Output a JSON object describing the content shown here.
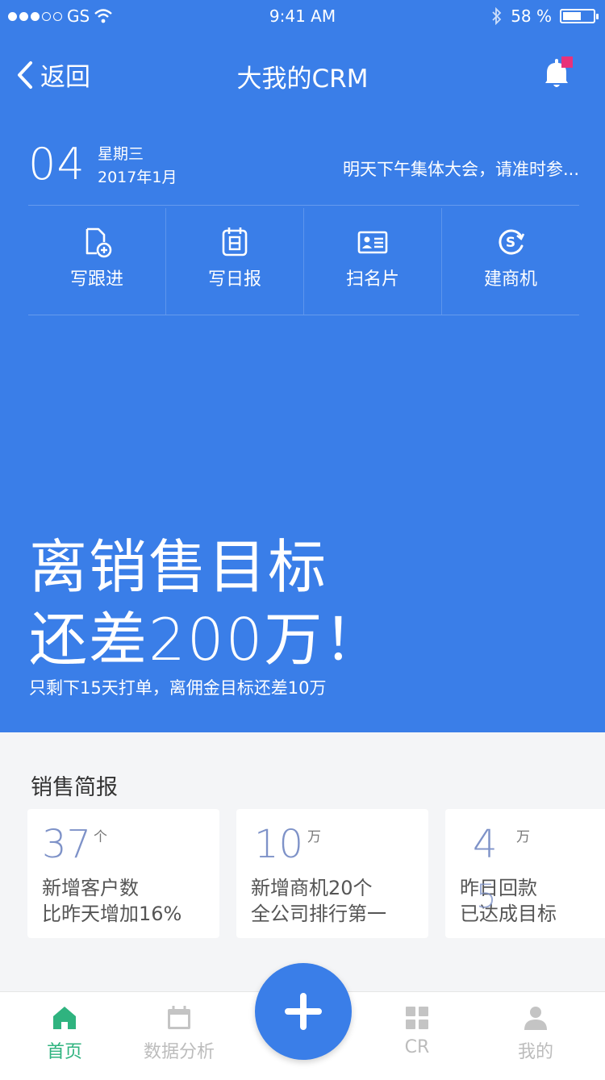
{
  "status_bar": {
    "carrier": "GS",
    "time": "9:41 AM",
    "battery": "58 %",
    "battery_level": 0.58
  },
  "nav": {
    "back_label": "返回",
    "title": "大我的CRM"
  },
  "date": {
    "day": "04",
    "weekday": "星期三",
    "year_month": "2017年1月",
    "notice": "明天下午集体大会，请准时参..."
  },
  "actions": [
    {
      "label": "写跟进",
      "icon": "add-file-icon"
    },
    {
      "label": "写日报",
      "icon": "calendar-icon"
    },
    {
      "label": "扫名片",
      "icon": "business-card-icon"
    },
    {
      "label": "建商机",
      "icon": "dollar-circle-icon"
    }
  ],
  "target": {
    "line1": "离销售目标",
    "line2": "还差200万！",
    "subline": "只剩下15天打单，离佣金目标还差10万"
  },
  "brief": {
    "title": "销售简报",
    "cards": [
      {
        "value": "37",
        "unit": "个",
        "line1": "新增客户数",
        "line2": "比昨天增加16%"
      },
      {
        "value": "10",
        "unit": "万",
        "line1": "新增商机20个",
        "line2": "全公司排行第一"
      },
      {
        "value": "4",
        "unit": "万",
        "line1": "昨日回款",
        "line2": "已达成目标",
        "overlay": "5"
      }
    ]
  },
  "tabs": [
    {
      "label": "首页",
      "icon": "home-icon",
      "active": true
    },
    {
      "label": "数据分析",
      "icon": "calendar-icon"
    },
    {
      "label": "CR",
      "icon": "grid-icon"
    },
    {
      "label": "我的",
      "icon": "user-icon"
    }
  ],
  "colors": {
    "primary": "#3a7ee8",
    "active_tab": "#2fb37f",
    "stat_number": "#7e92c8",
    "badge": "#e8327a"
  }
}
